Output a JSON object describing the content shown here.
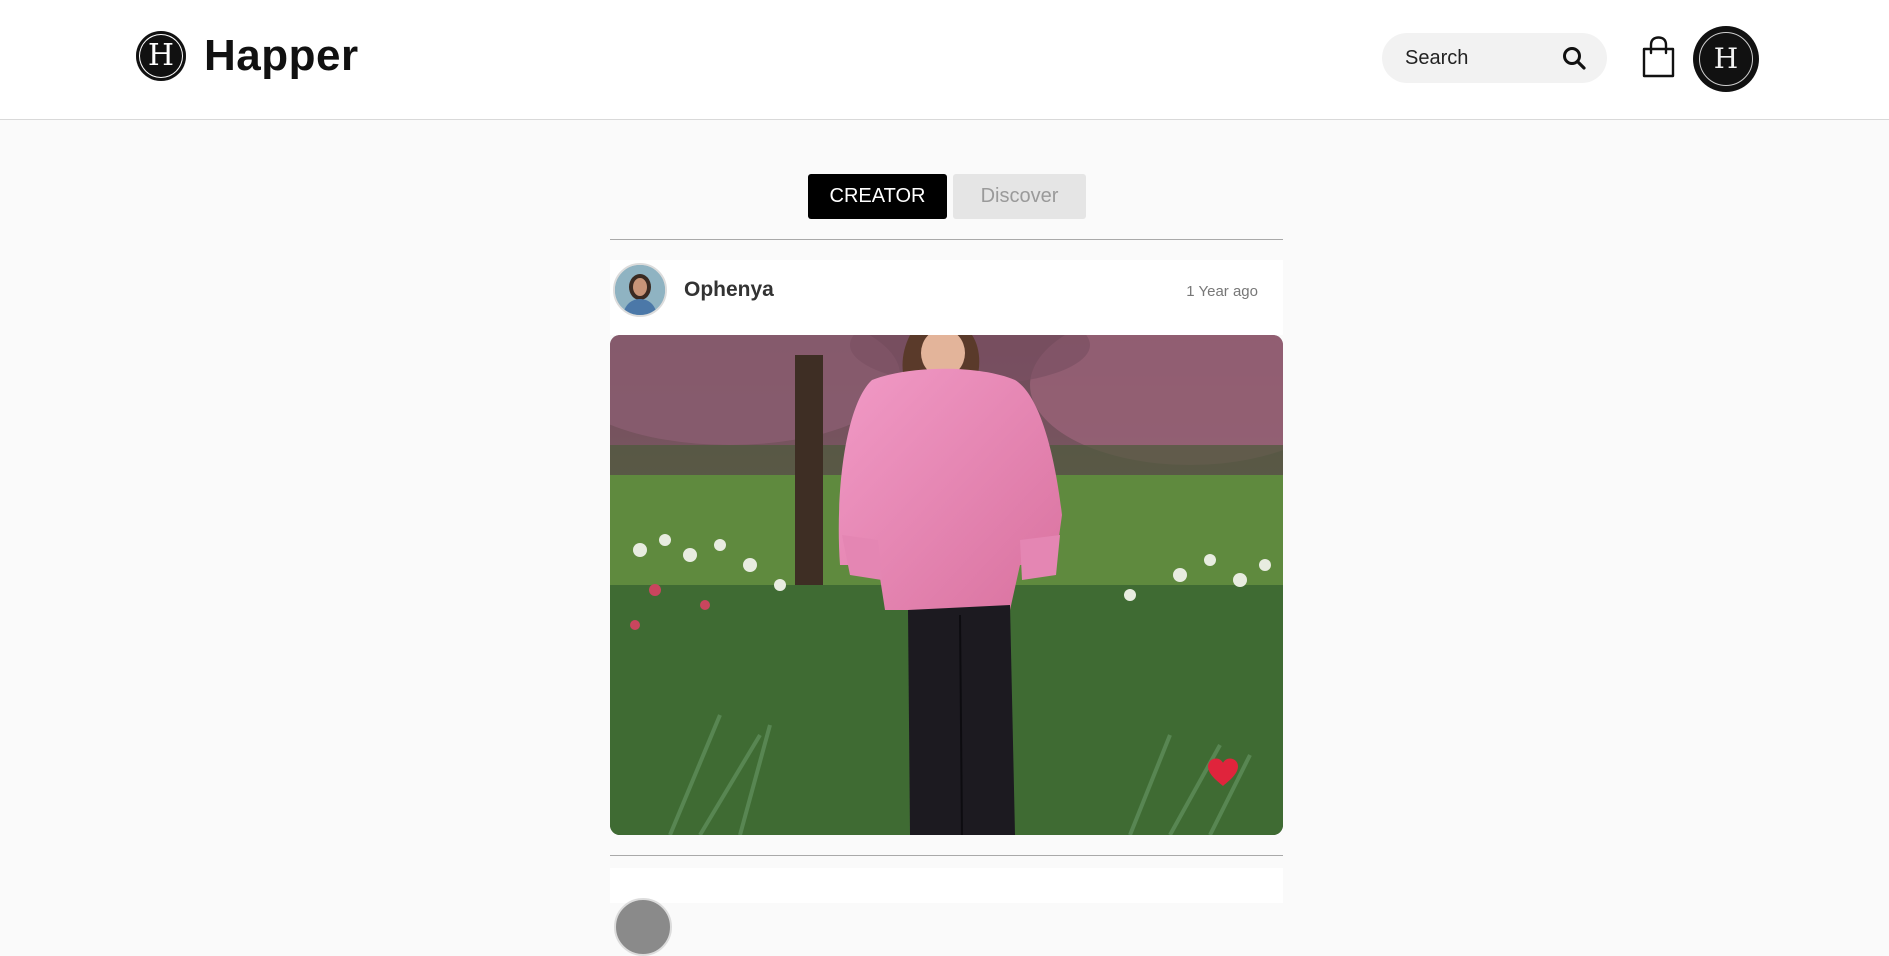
{
  "header": {
    "brand_mark": "H",
    "brand_name": "Happer",
    "search_placeholder": "Search",
    "icons": {
      "search": "search-icon",
      "cart": "shopping-bag-icon",
      "profile": "profile-avatar-icon"
    },
    "profile_initial": "H"
  },
  "tabs": [
    {
      "label": "CREATOR",
      "active": true
    },
    {
      "label": "Discover",
      "active": false
    }
  ],
  "feed": {
    "posts": [
      {
        "author": "Ophenya",
        "time": "1 Year ago",
        "liked": true,
        "heart_color": "#e0243c"
      }
    ]
  },
  "colors": {
    "accent": "#000000",
    "tab_inactive_bg": "#e5e5e5",
    "tab_inactive_text": "#9a9a9a",
    "like": "#e0243c"
  }
}
